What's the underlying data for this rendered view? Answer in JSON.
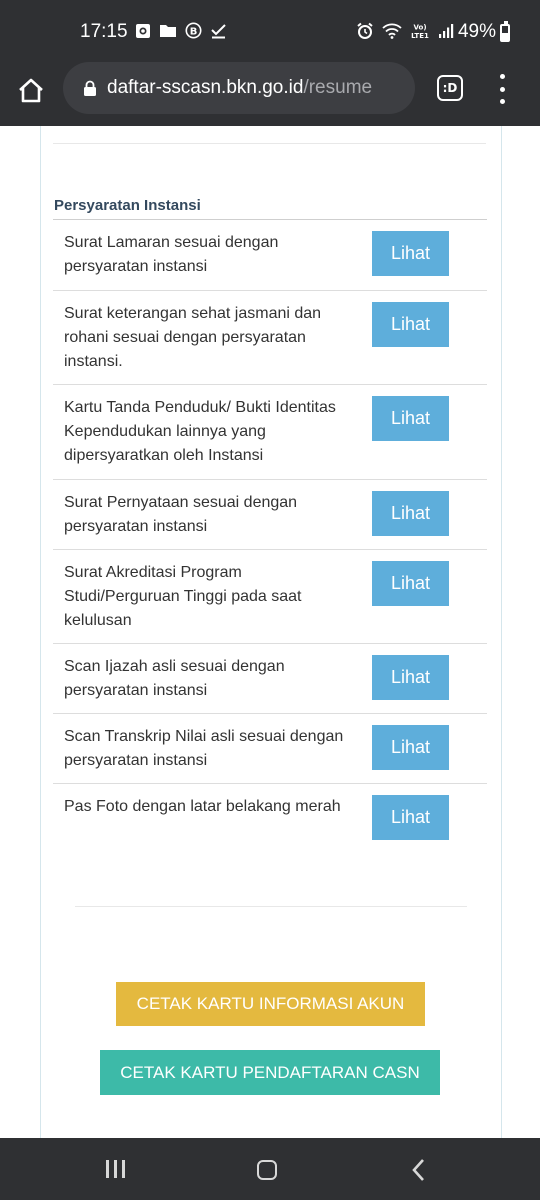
{
  "status_bar": {
    "time": "17:15",
    "battery": "49%"
  },
  "browser": {
    "url_domain": "daftar-sscasn.bkn.go.id",
    "url_path": "/resume",
    "tabs_label": ":D"
  },
  "section": {
    "title": "Persyaratan Instansi",
    "items": [
      {
        "label": "Surat Lamaran sesuai dengan persyaratan instansi",
        "button": "Lihat"
      },
      {
        "label": "Surat keterangan sehat jasmani dan rohani sesuai dengan persyaratan instansi.",
        "button": "Lihat"
      },
      {
        "label": "Kartu Tanda Penduduk/ Bukti Identitas Kependudukan lainnya yang dipersyaratkan oleh Instansi",
        "button": "Lihat"
      },
      {
        "label": "Surat Pernyataan sesuai dengan persyaratan instansi",
        "button": "Lihat"
      },
      {
        "label": "Surat Akreditasi Program Studi/Perguruan Tinggi pada saat kelulusan",
        "button": "Lihat"
      },
      {
        "label": "Scan Ijazah asli sesuai dengan persyaratan instansi",
        "button": "Lihat"
      },
      {
        "label": "Scan Transkrip Nilai asli sesuai dengan persyaratan instansi",
        "button": "Lihat"
      },
      {
        "label": "Pas Foto dengan latar belakang merah",
        "button": "Lihat"
      }
    ]
  },
  "actions": {
    "print_account_card": "CETAK KARTU INFORMASI AKUN",
    "print_registration_card": "CETAK KARTU PENDAFTARAN CASN"
  },
  "colors": {
    "lihat_button": "#5eaedb",
    "account_button": "#e4b93f",
    "registration_button": "#3dbaa8",
    "system_bar": "#2f3033"
  }
}
